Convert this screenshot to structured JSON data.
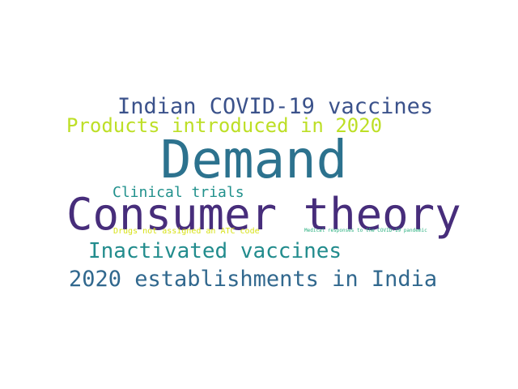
{
  "word_cloud": {
    "words": [
      {
        "text": "Demand",
        "color": "#2c728e"
      },
      {
        "text": "Consumer theory",
        "color": "#472d7b"
      },
      {
        "text": "Indian COVID-19 vaccines",
        "color": "#3b528b"
      },
      {
        "text": "Products introduced in 2020",
        "color": "#bddf26"
      },
      {
        "text": "Clinical trials",
        "color": "#21918c"
      },
      {
        "text": "Drugs not assigned an ATC code",
        "color": "#d8e219"
      },
      {
        "text": "Medical responses to the COVID-19 pandemic",
        "color": "#29af7f"
      },
      {
        "text": "Inactivated vaccines",
        "color": "#228c8d"
      },
      {
        "text": "2020 establishments in India",
        "color": "#31688e"
      }
    ]
  }
}
